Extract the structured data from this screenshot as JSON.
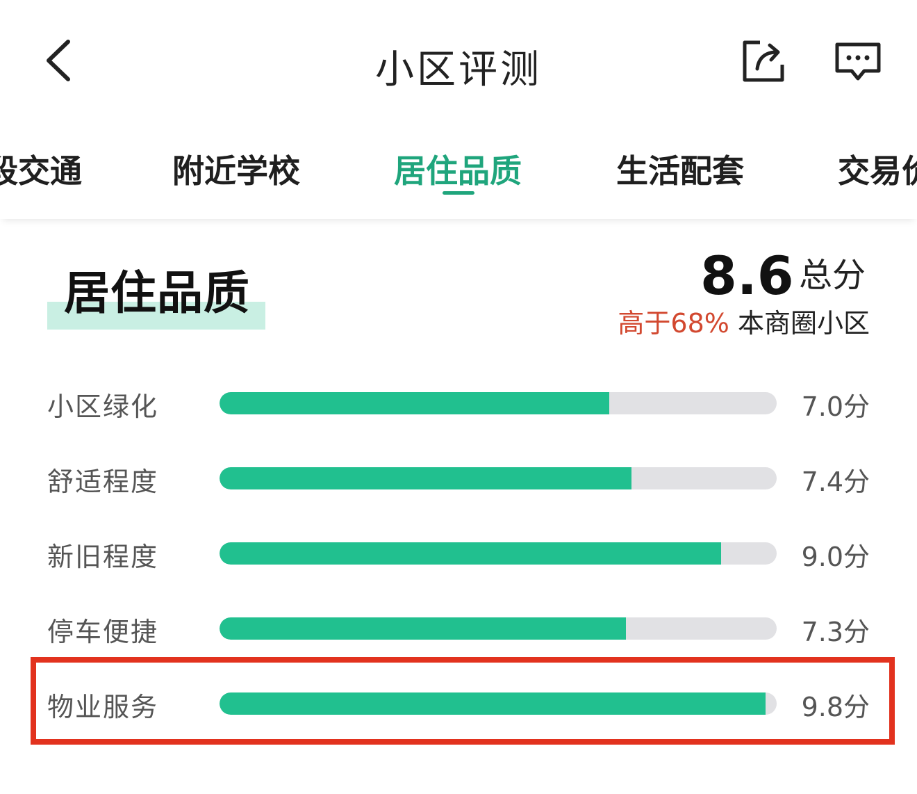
{
  "header": {
    "title": "小区评测"
  },
  "tabs": [
    {
      "label": "段交通"
    },
    {
      "label": "附近学校"
    },
    {
      "label": "居住品质",
      "active": true
    },
    {
      "label": "生活配套"
    },
    {
      "label": "交易价"
    }
  ],
  "section": {
    "title": "居住品质",
    "score": "8.6",
    "score_label": "总分",
    "compare_highlight": "高于68%",
    "compare_text": "本商圈小区"
  },
  "metrics": [
    {
      "label": "小区绿化",
      "value_text": "7.0分",
      "score": 7.0
    },
    {
      "label": "舒适程度",
      "value_text": "7.4分",
      "score": 7.4
    },
    {
      "label": "新旧程度",
      "value_text": "9.0分",
      "score": 9.0
    },
    {
      "label": "停车便捷",
      "value_text": "7.3分",
      "score": 7.3
    },
    {
      "label": "物业服务",
      "value_text": "9.8分",
      "score": 9.8,
      "highlighted": true
    }
  ],
  "colors": {
    "accent": "#1fa57c",
    "bar_fill": "#21c08f",
    "bar_track": "#e1e1e4",
    "compare_red": "#d2482f",
    "highlight_box": "#e2321e"
  },
  "icons": [
    "back-arrow-icon",
    "share-icon",
    "message-icon"
  ]
}
